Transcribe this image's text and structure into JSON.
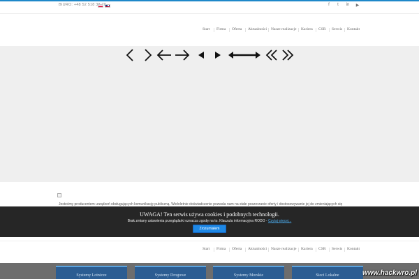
{
  "topbar": {
    "phone": "BIURO: +48 52 518 38 70",
    "flags": [
      "flag-pl-icon",
      "flag-en-icon"
    ],
    "social": [
      {
        "icon": "facebook-icon",
        "glyph": "f"
      },
      {
        "icon": "twitter-icon",
        "glyph": "t"
      },
      {
        "icon": "linkedin-icon",
        "glyph": "in"
      },
      {
        "icon": "youtube-icon",
        "glyph": "▶"
      }
    ]
  },
  "nav": {
    "items": [
      "Start",
      "Firma",
      "Oferta",
      "Aktualności",
      "Nasze realizacje",
      "Kariera",
      "CSR",
      "Serwis",
      "Kontakt"
    ]
  },
  "slider": {
    "arrows": [
      "chevron-left-icon",
      "chevron-right-icon",
      "arrow-left-icon",
      "arrow-right-icon",
      "triangle-left-icon",
      "triangle-right-icon",
      "long-arrow-left-icon",
      "long-arrow-right-icon",
      "double-chevron-left-icon",
      "double-chevron-right-icon"
    ]
  },
  "intro": {
    "text": "Jesteśmy producentem urządzeń obsługujących komunikację publiczną. Wieloletnie doświadczenie pozwala nam na stałe poszerzanie oferty i dostosowywanie jej do zmieniających się"
  },
  "cookie": {
    "title": "UWAGA! Ten serwis używa cookies i podobnych technologii.",
    "text": "Brak zmiany ustawienia przeglądarki oznacza zgodę na to. Klauzula informacyjna RODO - ",
    "link": "Czytaj więcej...",
    "button": "Zrozumiałem"
  },
  "boxes": [
    "Systemy Lotnicze",
    "Systemy Drogowe",
    "Systemy Morskie",
    "Sieci Lokalne"
  ],
  "watermark": "www.hackwro.pl",
  "colors": {
    "accent": "#1e88c9",
    "cookie_bg": "#262626",
    "cookie_button": "#1e88e5",
    "box_bg": "#2c5d92"
  }
}
